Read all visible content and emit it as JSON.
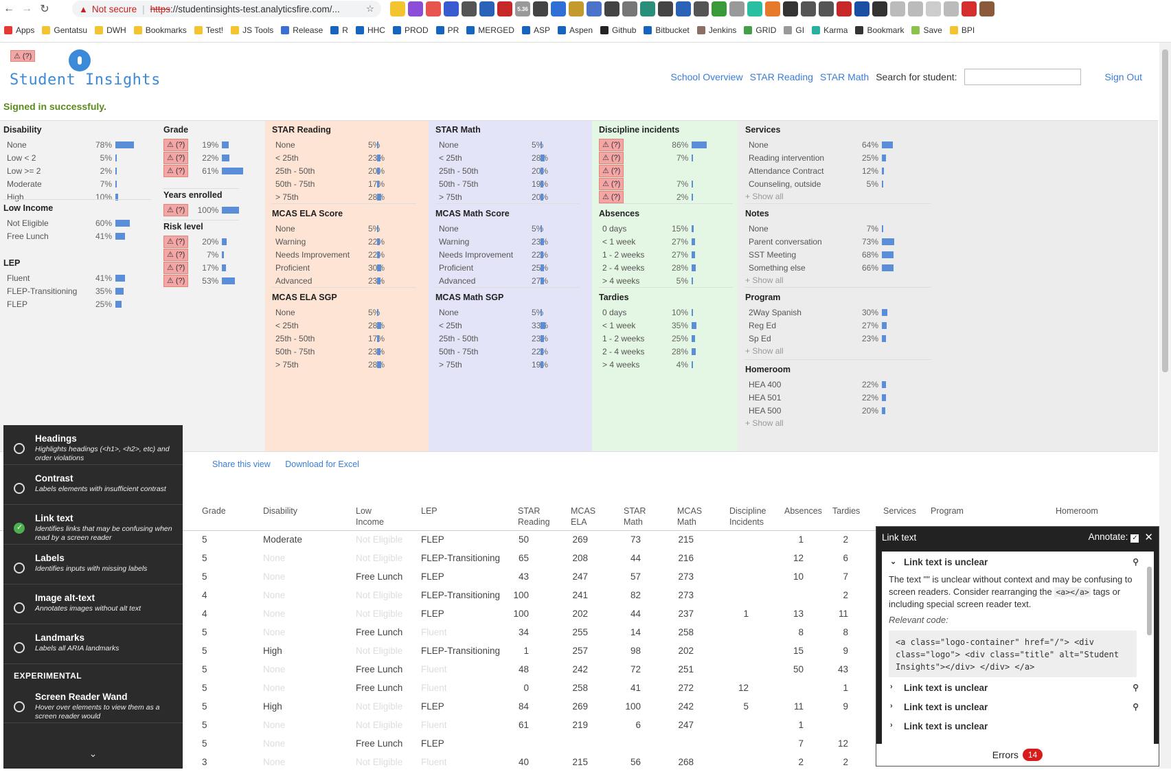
{
  "browser": {
    "not_secure": "Not secure",
    "url_scheme": "https",
    "url_rest": "://studentinsights-test.analyticsfire.com/...",
    "ext_badge": "5.36",
    "bookmarks": [
      "Apps",
      "Gentatsu",
      "DWH",
      "Bookmarks",
      "Test!",
      "JS Tools",
      "Release",
      "R",
      "HHC",
      "PROD",
      "PR",
      "MERGED",
      "ASP",
      "Aspen",
      "Github",
      "Bitbucket",
      "Jenkins",
      "GRID",
      "GI",
      "Karma",
      "Bookmark",
      "Save",
      "BPI"
    ]
  },
  "header": {
    "warn_badge": "(?)",
    "title": "Student Insights",
    "nav": {
      "school_overview": "School Overview",
      "star_reading": "STAR Reading",
      "star_math": "STAR Math",
      "search_label": "Search for student:",
      "sign_out": "Sign Out"
    },
    "flash": "Signed in successfuly."
  },
  "panels": {
    "disability": {
      "title": "Disability",
      "items": [
        {
          "label": "None",
          "pct": "78%",
          "v": 78
        },
        {
          "label": "Low < 2",
          "pct": "5%",
          "v": 5
        },
        {
          "label": "Low >= 2",
          "pct": "2%",
          "v": 2
        },
        {
          "label": "Moderate",
          "pct": "7%",
          "v": 7
        },
        {
          "label": "High",
          "pct": "10%",
          "v": 10
        }
      ]
    },
    "low_income": {
      "title": "Low Income",
      "items": [
        {
          "label": "Not Eligible",
          "pct": "60%",
          "v": 60
        },
        {
          "label": "Free Lunch",
          "pct": "41%",
          "v": 41
        }
      ]
    },
    "lep": {
      "title": "LEP",
      "items": [
        {
          "label": "Fluent",
          "pct": "41%",
          "v": 41
        },
        {
          "label": "FLEP-Transitioning",
          "pct": "35%",
          "v": 35
        },
        {
          "label": "FLEP",
          "pct": "25%",
          "v": 25
        }
      ]
    },
    "grade": {
      "title": "Grade",
      "items": [
        {
          "label": "(?)",
          "pct": "19%",
          "v": 19
        },
        {
          "label": "(?)",
          "pct": "22%",
          "v": 22
        },
        {
          "label": "(?)",
          "pct": "61%",
          "v": 61
        }
      ]
    },
    "years": {
      "title": "Years enrolled",
      "items": [
        {
          "label": "(?)",
          "pct": "100%",
          "v": 100
        }
      ]
    },
    "risk": {
      "title": "Risk level",
      "items": [
        {
          "label": "(?)",
          "pct": "20%",
          "v": 20
        },
        {
          "label": "(?)",
          "pct": "7%",
          "v": 7
        },
        {
          "label": "(?)",
          "pct": "17%",
          "v": 17
        },
        {
          "label": "(?)",
          "pct": "53%",
          "v": 53
        }
      ]
    },
    "star_reading": {
      "title": "STAR Reading",
      "items": [
        {
          "label": "None",
          "pct": "5%",
          "v": 5
        },
        {
          "label": "< 25th",
          "pct": "23%",
          "v": 23
        },
        {
          "label": "25th - 50th",
          "pct": "20%",
          "v": 20
        },
        {
          "label": "50th - 75th",
          "pct": "17%",
          "v": 17
        },
        {
          "label": "> 75th",
          "pct": "28%",
          "v": 28
        }
      ]
    },
    "mcas_ela": {
      "title": "MCAS ELA Score",
      "items": [
        {
          "label": "None",
          "pct": "5%",
          "v": 5
        },
        {
          "label": "Warning",
          "pct": "22%",
          "v": 22
        },
        {
          "label": "Needs Improvement",
          "pct": "22%",
          "v": 22
        },
        {
          "label": "Proficient",
          "pct": "30%",
          "v": 30
        },
        {
          "label": "Advanced",
          "pct": "23%",
          "v": 23
        }
      ]
    },
    "mcas_ela_sgp": {
      "title": "MCAS ELA SGP",
      "items": [
        {
          "label": "None",
          "pct": "5%",
          "v": 5
        },
        {
          "label": "< 25th",
          "pct": "28%",
          "v": 28
        },
        {
          "label": "25th - 50th",
          "pct": "17%",
          "v": 17
        },
        {
          "label": "50th - 75th",
          "pct": "23%",
          "v": 23
        },
        {
          "label": "> 75th",
          "pct": "28%",
          "v": 28
        }
      ]
    },
    "star_math": {
      "title": "STAR Math",
      "items": [
        {
          "label": "None",
          "pct": "5%",
          "v": 5
        },
        {
          "label": "< 25th",
          "pct": "28%",
          "v": 28
        },
        {
          "label": "25th - 50th",
          "pct": "20%",
          "v": 20
        },
        {
          "label": "50th - 75th",
          "pct": "19%",
          "v": 19
        },
        {
          "label": "> 75th",
          "pct": "20%",
          "v": 20
        }
      ]
    },
    "mcas_math": {
      "title": "MCAS Math Score",
      "items": [
        {
          "label": "None",
          "pct": "5%",
          "v": 5
        },
        {
          "label": "Warning",
          "pct": "23%",
          "v": 23
        },
        {
          "label": "Needs Improvement",
          "pct": "22%",
          "v": 22
        },
        {
          "label": "Proficient",
          "pct": "25%",
          "v": 25
        },
        {
          "label": "Advanced",
          "pct": "27%",
          "v": 27
        }
      ]
    },
    "mcas_math_sgp": {
      "title": "MCAS Math SGP",
      "items": [
        {
          "label": "None",
          "pct": "5%",
          "v": 5
        },
        {
          "label": "< 25th",
          "pct": "33%",
          "v": 33
        },
        {
          "label": "25th - 50th",
          "pct": "23%",
          "v": 23
        },
        {
          "label": "50th - 75th",
          "pct": "22%",
          "v": 22
        },
        {
          "label": "> 75th",
          "pct": "19%",
          "v": 19
        }
      ]
    },
    "discipline": {
      "title": "Discipline incidents",
      "items": [
        {
          "label": "(?)",
          "pct": "86%",
          "v": 86
        },
        {
          "label": "(?)",
          "pct": "7%",
          "v": 7
        },
        {
          "label": "(?)",
          "pct": "",
          "v": 0
        },
        {
          "label": "(?)",
          "pct": "7%",
          "v": 7
        },
        {
          "label": "(?)",
          "pct": "2%",
          "v": 2
        }
      ]
    },
    "absences": {
      "title": "Absences",
      "items": [
        {
          "label": "0 days",
          "pct": "15%",
          "v": 15
        },
        {
          "label": "< 1 week",
          "pct": "27%",
          "v": 27
        },
        {
          "label": "1 - 2 weeks",
          "pct": "27%",
          "v": 27
        },
        {
          "label": "2 - 4 weeks",
          "pct": "28%",
          "v": 28
        },
        {
          "label": "> 4 weeks",
          "pct": "5%",
          "v": 5
        }
      ]
    },
    "tardies": {
      "title": "Tardies",
      "items": [
        {
          "label": "0 days",
          "pct": "10%",
          "v": 10
        },
        {
          "label": "< 1 week",
          "pct": "35%",
          "v": 35
        },
        {
          "label": "1 - 2 weeks",
          "pct": "25%",
          "v": 25
        },
        {
          "label": "2 - 4 weeks",
          "pct": "28%",
          "v": 28
        },
        {
          "label": "> 4 weeks",
          "pct": "4%",
          "v": 4
        }
      ]
    },
    "services": {
      "title": "Services",
      "items": [
        {
          "label": "None",
          "pct": "64%",
          "v": 64
        },
        {
          "label": "Reading intervention",
          "pct": "25%",
          "v": 25
        },
        {
          "label": "Attendance Contract",
          "pct": "12%",
          "v": 12
        },
        {
          "label": "Counseling, outside",
          "pct": "5%",
          "v": 5
        }
      ],
      "show_all": "+ Show all"
    },
    "notes": {
      "title": "Notes",
      "items": [
        {
          "label": "None",
          "pct": "7%",
          "v": 7
        },
        {
          "label": "Parent conversation",
          "pct": "73%",
          "v": 73
        },
        {
          "label": "SST Meeting",
          "pct": "68%",
          "v": 68
        },
        {
          "label": "Something else",
          "pct": "66%",
          "v": 66
        }
      ],
      "show_all": "+ Show all"
    },
    "program": {
      "title": "Program",
      "items": [
        {
          "label": "2Way Spanish",
          "pct": "30%",
          "v": 30
        },
        {
          "label": "Reg Ed",
          "pct": "27%",
          "v": 27
        },
        {
          "label": "Sp Ed",
          "pct": "23%",
          "v": 23
        }
      ],
      "show_all": "+ Show all"
    },
    "homeroom": {
      "title": "Homeroom",
      "items": [
        {
          "label": "HEA 400",
          "pct": "22%",
          "v": 22
        },
        {
          "label": "HEA 501",
          "pct": "22%",
          "v": 22
        },
        {
          "label": "HEA 500",
          "pct": "20%",
          "v": 20
        }
      ],
      "show_all": "+ Show all"
    }
  },
  "actions": {
    "share": "Share this view",
    "download": "Download for Excel"
  },
  "table": {
    "headers": [
      "Grade",
      "Disability",
      "Low\nIncome",
      "LEP",
      "STAR\nReading",
      "MCAS\nELA",
      "STAR\nMath",
      "MCAS\nMath",
      "Discipline\nIncidents",
      "Absences",
      "Tardies",
      "Services",
      "Program",
      "Homeroom"
    ],
    "rows": [
      [
        "5",
        "Moderate",
        "Not Eligible",
        "FLEP",
        "50",
        "269",
        "73",
        "215",
        "",
        "1",
        "2"
      ],
      [
        "5",
        "None",
        "Not Eligible",
        "FLEP-Transitioning",
        "65",
        "208",
        "44",
        "216",
        "",
        "12",
        "6"
      ],
      [
        "5",
        "None",
        "Free Lunch",
        "FLEP",
        "43",
        "247",
        "57",
        "273",
        "",
        "10",
        "7"
      ],
      [
        "4",
        "None",
        "Not Eligible",
        "FLEP-Transitioning",
        "100",
        "241",
        "82",
        "273",
        "",
        "",
        "2"
      ],
      [
        "4",
        "None",
        "Not Eligible",
        "FLEP",
        "100",
        "202",
        "44",
        "237",
        "1",
        "13",
        "11"
      ],
      [
        "5",
        "None",
        "Free Lunch",
        "Fluent",
        "34",
        "255",
        "14",
        "258",
        "",
        "8",
        "8"
      ],
      [
        "5",
        "High",
        "Not Eligible",
        "FLEP-Transitioning",
        "1",
        "257",
        "98",
        "202",
        "",
        "15",
        "9"
      ],
      [
        "5",
        "None",
        "Free Lunch",
        "Fluent",
        "48",
        "242",
        "72",
        "251",
        "",
        "50",
        "43"
      ],
      [
        "5",
        "None",
        "Free Lunch",
        "Fluent",
        "0",
        "258",
        "41",
        "272",
        "12",
        "",
        "1"
      ],
      [
        "5",
        "High",
        "Not Eligible",
        "FLEP",
        "84",
        "269",
        "100",
        "242",
        "5",
        "11",
        "9"
      ],
      [
        "5",
        "None",
        "Not Eligible",
        "Fluent",
        "61",
        "219",
        "6",
        "247",
        "",
        "1",
        ""
      ],
      [
        "5",
        "None",
        "Free Lunch",
        "FLEP",
        "",
        "",
        "",
        "",
        "",
        "7",
        "12"
      ],
      [
        "3",
        "None",
        "Not Eligible",
        "Fluent",
        "40",
        "215",
        "56",
        "268",
        "",
        "2",
        "2"
      ]
    ]
  },
  "a11y": {
    "items": [
      {
        "title": "Headings",
        "desc": "Highlights headings (<h1>, <h2>, etc) and order violations",
        "on": false
      },
      {
        "title": "Contrast",
        "desc": "Labels elements with insufficient contrast",
        "on": false
      },
      {
        "title": "Link text",
        "desc": "Identifies links that may be confusing when read by a screen reader",
        "on": true
      },
      {
        "title": "Labels",
        "desc": "Identifies inputs with missing labels",
        "on": false
      },
      {
        "title": "Image alt-text",
        "desc": "Annotates images without alt text",
        "on": false
      },
      {
        "title": "Landmarks",
        "desc": "Labels all ARIA landmarks",
        "on": false
      }
    ],
    "experimental": "EXPERIMENTAL",
    "wand": {
      "title": "Screen Reader Wand",
      "desc": "Hover over elements to view them as a screen reader would"
    }
  },
  "error_panel": {
    "title": "Link text",
    "annotate": "Annotate:",
    "issue_title": "Link text is unclear",
    "desc_pre": "The text \"\" is unclear without context and may be confusing to screen readers. Consider rearranging the ",
    "desc_code": "<a></a>",
    "desc_post": " tags or including special screen reader text.",
    "relevant": "Relevant code:",
    "code": "<a class=\"logo-container\" href=\"/\"> <div class=\"logo\"> <div class=\"title\" alt=\"Student Insights\"></div> </div> </a>",
    "errors_label": "Errors",
    "errors_count": "14"
  },
  "colors": {
    "link": "#3b7dd8",
    "bar": "#5a8ed8",
    "reading_bg": "#fde4d4",
    "math_bg": "#e4e4f8",
    "behavior_bg": "#e4f6e4",
    "services_bg": "#ececec",
    "demo_bg": "#f2f2f2",
    "warn": "#f4a6a6"
  }
}
